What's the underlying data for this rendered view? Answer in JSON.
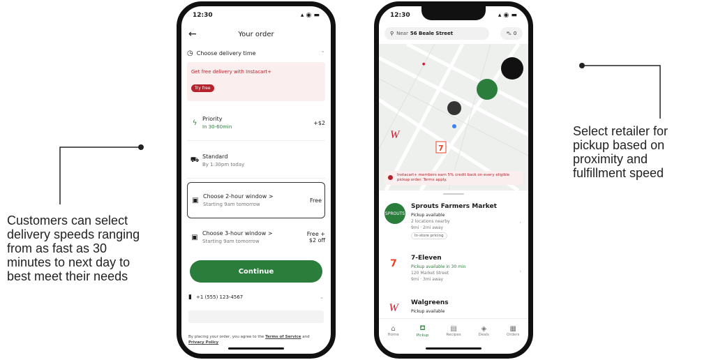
{
  "captions": {
    "left": "Customers can select delivery speeds ranging from as fast as 30 minutes to next day to best meet their needs",
    "right": "Select retailer for pickup based on proximity and fulfillment speed"
  },
  "colors": {
    "brand_green": "#2b7d3c",
    "promo_red": "#b4232c"
  },
  "phone1": {
    "time": "12:30",
    "title": "Your order",
    "section": "Choose delivery time",
    "promo_text": "Get free delivery with Instacart+",
    "promo_button": "Try free",
    "options": [
      {
        "icon": "lightning-icon",
        "label": "Priority",
        "sub": "In 30-60min",
        "price": "+$2"
      },
      {
        "icon": "car-icon",
        "label": "Standard",
        "sub": "By 1:30pm today",
        "price": ""
      },
      {
        "icon": "calendar-icon",
        "label": "Choose 2-hour window >",
        "sub": "Starting 9am tomorrow",
        "price": "Free"
      },
      {
        "icon": "calendar-icon",
        "label": "Choose 3-hour window >",
        "sub": "Starting 9am tomorrow",
        "price": "Free + $2 off"
      }
    ],
    "continue": "Continue",
    "phone_number": "+1 (555) 123-4567",
    "terms_prefix": "By placing your order, you agree to the",
    "terms_link1": "Terms of Service",
    "terms_and": "and",
    "terms_link2": "Privacy Policy"
  },
  "phone2": {
    "time": "12:30",
    "address_prefix": "Near",
    "address": "56 Beale Street",
    "cart_count": "0",
    "banner": "Instacart+ members earn 5% credit back on every eligible pickup order. Terms apply.",
    "stores": [
      {
        "name": "Sprouts Farmers Market",
        "logo_text": "SPROUTS",
        "color": "#2b7d3c",
        "lines": [
          "Pickup available",
          "2 locations nearby",
          "9mi · 2mi away"
        ],
        "chip": "In-store pricing"
      },
      {
        "name": "7-Eleven",
        "logo_text": "7",
        "color": "#e8432a",
        "lines": [
          "Pickup available in 30 min",
          "120 Market Street",
          "9mi · 3mi away"
        ],
        "chip": ""
      },
      {
        "name": "Walgreens",
        "logo_text": "W",
        "color": "#d3192e",
        "lines": [
          "Pickup available"
        ],
        "chip": ""
      }
    ],
    "tabs": [
      {
        "icon": "home-icon",
        "label": "Home"
      },
      {
        "icon": "pickup-icon",
        "label": "Pickup"
      },
      {
        "icon": "recipes-icon",
        "label": "Recipes"
      },
      {
        "icon": "deals-icon",
        "label": "Deals"
      },
      {
        "icon": "orders-icon",
        "label": "Orders"
      }
    ]
  }
}
